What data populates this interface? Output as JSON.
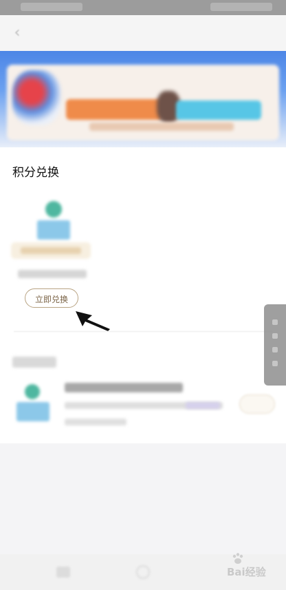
{
  "section": {
    "points_exchange_title": "积分兑换"
  },
  "exchange_item": {
    "button_label": "立即兑换"
  },
  "watermark": {
    "text": "Bai经验"
  },
  "colors": {
    "banner_blue": "#4d86e6",
    "button_border": "#b8a382",
    "button_text": "#7b6447"
  },
  "icons": {
    "back": "chevron-left-icon",
    "pointer": "arrow-icon"
  }
}
